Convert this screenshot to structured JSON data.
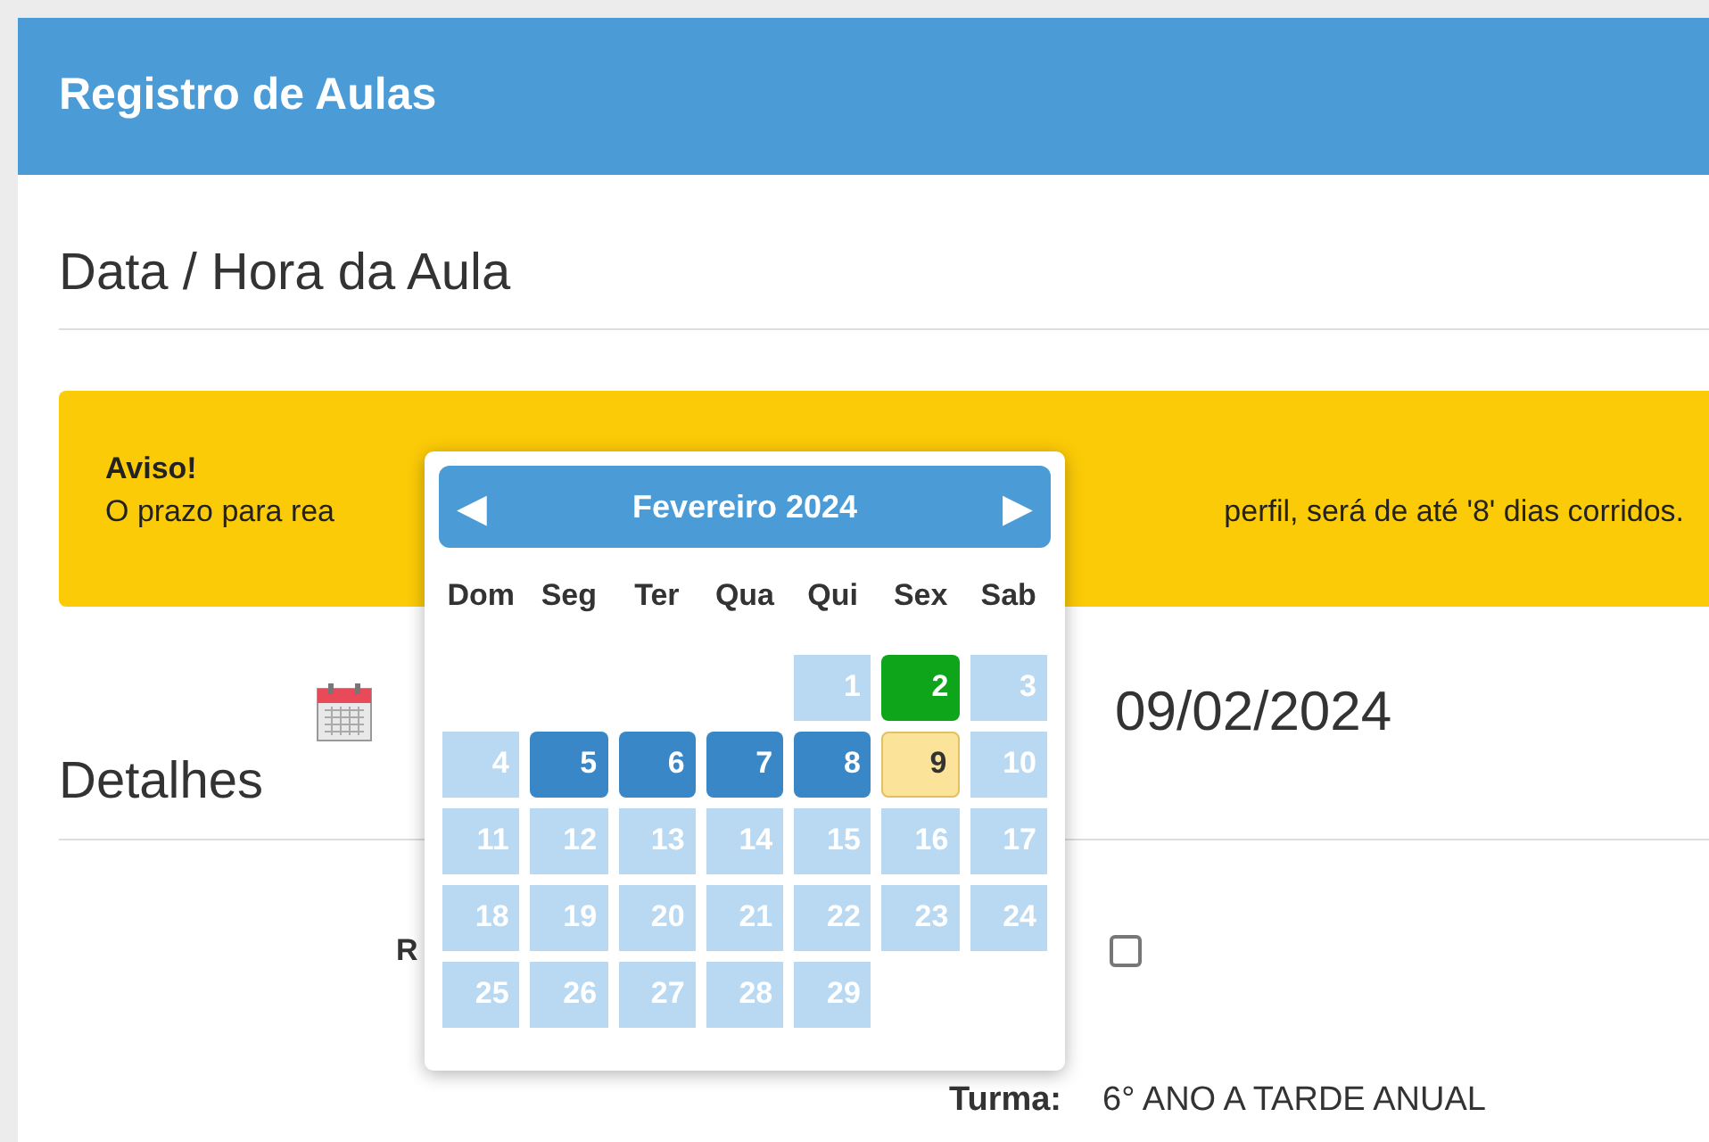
{
  "header": {
    "title": "Registro de Aulas"
  },
  "section_date": {
    "title": "Data / Hora da Aula"
  },
  "alert": {
    "title": "Aviso!",
    "text_before": "O prazo para rea",
    "text_after": "perfil, será de até '8' dias corridos."
  },
  "date_field": {
    "value": "09/02/2024"
  },
  "section_details": {
    "title": "Detalhes"
  },
  "details": {
    "label_1": "R",
    "checkbox_checked": false,
    "turma_label": "Turma:",
    "turma_value": "6° ANO A TARDE ANUAL"
  },
  "datepicker": {
    "month": "Fevereiro 2024",
    "prev": "◀",
    "next": "▶",
    "weekdays": [
      "Dom",
      "Seg",
      "Ter",
      "Qua",
      "Qui",
      "Sex",
      "Sab"
    ],
    "weeks": [
      [
        {
          "kind": "blank"
        },
        {
          "kind": "blank"
        },
        {
          "kind": "blank"
        },
        {
          "kind": "blank"
        },
        {
          "day": "1",
          "kind": "unavailable",
          "selected": false
        },
        {
          "day": "2",
          "kind": "today",
          "selected": false
        },
        {
          "day": "3",
          "kind": "unavailable",
          "selected": false
        }
      ],
      [
        {
          "day": "4",
          "kind": "unavailable",
          "selected": false
        },
        {
          "day": "5",
          "kind": "available",
          "selected": false
        },
        {
          "day": "6",
          "kind": "available",
          "selected": false
        },
        {
          "day": "7",
          "kind": "available",
          "selected": false
        },
        {
          "day": "8",
          "kind": "available",
          "selected": false
        },
        {
          "day": "9",
          "kind": "available",
          "selected": true
        },
        {
          "day": "10",
          "kind": "unavailable",
          "selected": false
        }
      ],
      [
        {
          "day": "11",
          "kind": "unavailable",
          "selected": false
        },
        {
          "day": "12",
          "kind": "unavailable",
          "selected": false
        },
        {
          "day": "13",
          "kind": "unavailable",
          "selected": false
        },
        {
          "day": "14",
          "kind": "unavailable",
          "selected": false
        },
        {
          "day": "15",
          "kind": "unavailable",
          "selected": false
        },
        {
          "day": "16",
          "kind": "unavailable",
          "selected": false
        },
        {
          "day": "17",
          "kind": "unavailable",
          "selected": false
        }
      ],
      [
        {
          "day": "18",
          "kind": "unavailable",
          "selected": false
        },
        {
          "day": "19",
          "kind": "unavailable",
          "selected": false
        },
        {
          "day": "20",
          "kind": "unavailable",
          "selected": false
        },
        {
          "day": "21",
          "kind": "unavailable",
          "selected": false
        },
        {
          "day": "22",
          "kind": "unavailable",
          "selected": false
        },
        {
          "day": "23",
          "kind": "unavailable",
          "selected": false
        },
        {
          "day": "24",
          "kind": "unavailable",
          "selected": false
        }
      ],
      [
        {
          "day": "25",
          "kind": "unavailable",
          "selected": false
        },
        {
          "day": "26",
          "kind": "unavailable",
          "selected": false
        },
        {
          "day": "27",
          "kind": "unavailable",
          "selected": false
        },
        {
          "day": "28",
          "kind": "unavailable",
          "selected": false
        },
        {
          "day": "29",
          "kind": "unavailable",
          "selected": false
        },
        {
          "kind": "blank"
        },
        {
          "kind": "blank"
        }
      ]
    ]
  }
}
